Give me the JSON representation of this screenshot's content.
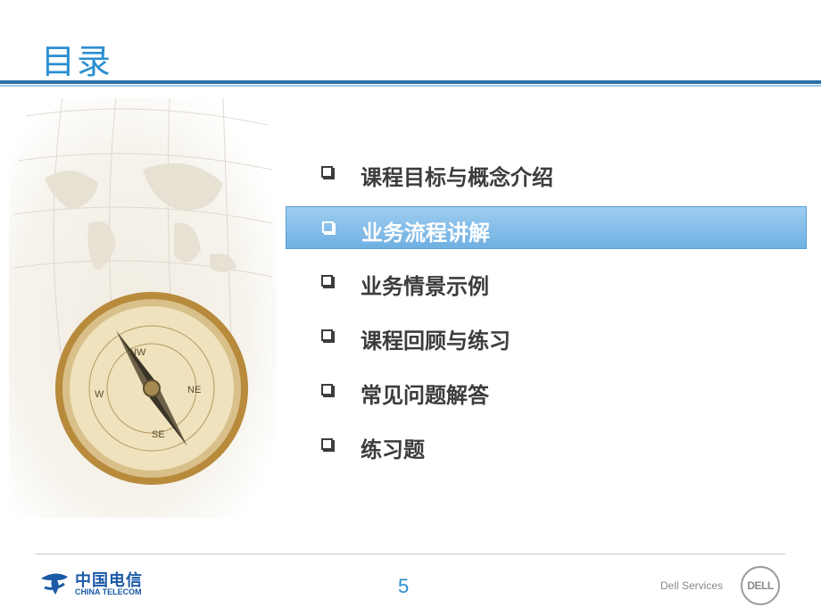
{
  "slide": {
    "title": "目录",
    "accent_color": "#2b8fd0"
  },
  "menu": {
    "items": [
      {
        "label": "课程目标与概念介绍",
        "active": false
      },
      {
        "label": "业务流程讲解",
        "active": true
      },
      {
        "label": "业务情景示例",
        "active": false
      },
      {
        "label": "课程回顾与练习",
        "active": false
      },
      {
        "label": "常见问题解答",
        "active": false
      },
      {
        "label": "练习题",
        "active": false
      }
    ],
    "bullet_icon": "checkbox-bullet-icon"
  },
  "footer": {
    "brand_cn": "中国电信",
    "brand_en": "CHINA TELECOM",
    "page_number": "5",
    "vendor_text": "Dell Services",
    "vendor_logo": "DELL"
  }
}
